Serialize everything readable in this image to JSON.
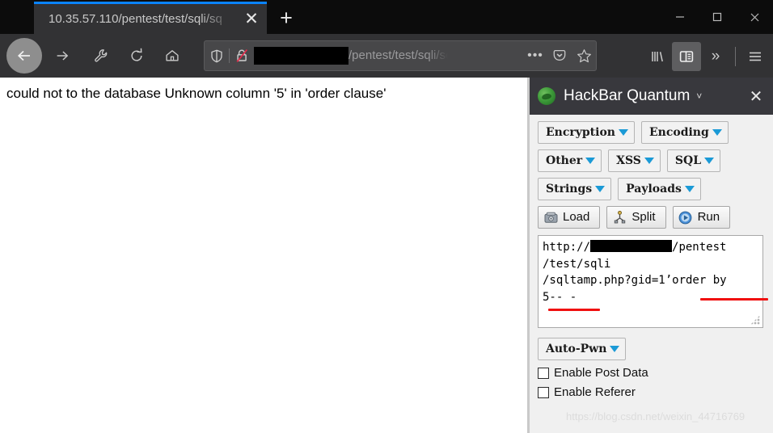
{
  "window": {
    "minimize_label": "minimize-icon",
    "maximize_label": "maximize-icon",
    "close_label": "close-icon"
  },
  "tab": {
    "title": "10.35.57.110/pentest/test/sqli/sq",
    "close_label": "✕",
    "newtab_label": "+"
  },
  "nav": {
    "back_icon": "back-arrow-icon",
    "forward_icon": "forward-arrow-icon",
    "wrench_icon": "wrench-icon",
    "reload_icon": "reload-icon",
    "home_icon": "home-icon",
    "library_icon": "library-icon",
    "sidebar_icon": "sidebar-toggle-icon",
    "overflow_label": "»",
    "menu_icon": "hamburger-menu-icon"
  },
  "urlbar": {
    "redacted": "",
    "path": "/pentest/test/sqli/sq",
    "shield_icon": "shield-icon",
    "lock_icon": "broken-lock-icon",
    "more_label": "•••",
    "pocket_icon": "pocket-icon",
    "bookmark_icon": "star-icon"
  },
  "page": {
    "body_text": "could not to the database Unknown column '5' in 'order clause'"
  },
  "sidebar": {
    "title": "HackBar Quantum",
    "caret": "˅",
    "close_label": "✕",
    "logo_icon": "hackbar-logo-icon",
    "button_rows": [
      [
        {
          "label": "Encryption"
        },
        {
          "label": "Encoding"
        }
      ],
      [
        {
          "label": "Other"
        },
        {
          "label": "XSS"
        },
        {
          "label": "SQL"
        }
      ],
      [
        {
          "label": "Strings"
        },
        {
          "label": "Payloads"
        }
      ]
    ],
    "tools": [
      {
        "label": "Load",
        "icon": "load-icon"
      },
      {
        "label": "Split",
        "icon": "split-icon"
      },
      {
        "label": "Run",
        "icon": "run-icon"
      }
    ],
    "request": {
      "line1_prefix": "http://",
      "line1_suffix": "/pentest",
      "rest": "\n/test/sqli\n/sqltamp.php?gid=1’order by\n5-- -"
    },
    "autopwn": {
      "label": "Auto-Pwn"
    },
    "checkboxes": [
      {
        "label": "Enable Post Data",
        "checked": false
      },
      {
        "label": "Enable Referer",
        "checked": false
      }
    ]
  },
  "watermark": {
    "text": "https://blog.csdn.net/weixin_44716769"
  },
  "colors": {
    "accent_blue": "#0a84ff",
    "dropdown_arrow": "#1b9ad6",
    "annotation_red": "#f01010",
    "chrome_dark": "#323234",
    "titlebar": "#0c0c0c",
    "sidebar_bg": "#f0f0f0",
    "sidebar_header": "#38383d"
  }
}
